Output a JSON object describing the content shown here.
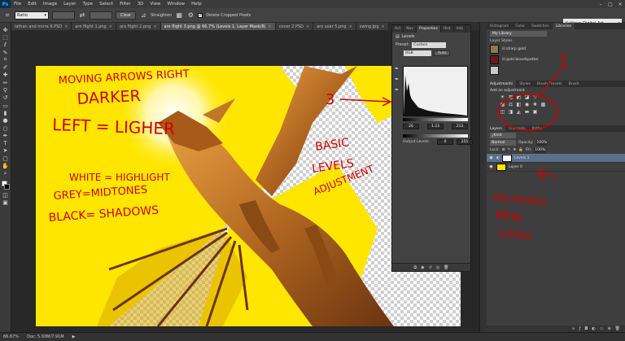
{
  "app": {
    "logo": "Ps"
  },
  "menu": [
    "File",
    "Edit",
    "Image",
    "Layer",
    "Type",
    "Select",
    "Filter",
    "3D",
    "View",
    "Window",
    "Help"
  ],
  "window_controls": [
    "–",
    "□",
    "✕"
  ],
  "options_bar": {
    "ratio_label": "Ratio",
    "clear_label": "Clear",
    "straighten_label": "Straighten",
    "delete_cropped_label": "Delete Cropped Pixels",
    "workspace_label": "Kathryn Digital Art"
  },
  "tabs": [
    {
      "label": "lathan and mirra 6.PSD",
      "active": false
    },
    {
      "label": "aro flight 1.png",
      "active": false
    },
    {
      "label": "aro flight 2.png",
      "active": false
    },
    {
      "label": "aro flight 3.png @ 66.7% (Levels 1, Layer Mask/8)",
      "active": true
    },
    {
      "label": "cover 2.PSD",
      "active": false
    },
    {
      "label": "aro soar 5.png",
      "active": false
    },
    {
      "label": "swing.jpg",
      "active": false
    }
  ],
  "properties": {
    "tabs": [
      "Act",
      "Nav",
      "Properties",
      "Hist",
      "Info"
    ],
    "title": "Levels",
    "preset_label": "Preset:",
    "preset_value": "Custom",
    "channel": "RGB",
    "auto_label": "Auto",
    "input_black": "26",
    "input_mid": "1.23",
    "input_white": "213",
    "output_label": "Output Levels:",
    "output_black": "0",
    "output_white": "255"
  },
  "right_panel": {
    "lib_tabs": [
      "Histogram",
      "Color",
      "Swatches",
      "Libraries"
    ],
    "library_select": "My Library",
    "layer_styles_label": "Layer Styles",
    "library_items": [
      {
        "label": "lil sharp gold",
        "color": "#8a7a55"
      },
      {
        "label": "lil gold bloodspatter",
        "color": "#6a1a1a"
      },
      {
        "label": "",
        "color": "#c8c8c8"
      }
    ],
    "adj_tabs": [
      "Adjustments",
      "Styles",
      "Brush Presets",
      "Brush"
    ],
    "adj_title": "Add an adjustment",
    "layers_tabs": [
      "Layers",
      "Channels",
      "Paths"
    ],
    "kind_label": "Kind",
    "blend_mode": "Normal",
    "opacity_label": "Opacity:",
    "opacity_value": "100%",
    "lock_label": "Lock:",
    "fill_label": "Fill:",
    "fill_value": "100%",
    "layers": [
      {
        "name": "Levels 1",
        "selected": true,
        "thumb": "white"
      },
      {
        "name": "Layer 0",
        "selected": false,
        "thumb": "yellow"
      }
    ]
  },
  "status": {
    "zoom": "66.67%",
    "doc": "Doc: 5.93M/7.91M"
  },
  "annotations": {
    "line1": "MOVING ARROWS RIGHT",
    "line2": "DARKER",
    "line3": "LEFT = LIGHER",
    "line4": "WHITE = HIGHLIGHT",
    "line5": "GREY=MIDTONES",
    "line6": "BLACK= SHADOWS",
    "basic1": "BASIC",
    "basic2": "LEVELS",
    "basic3": "ADJUSTMENT",
    "num3": "3",
    "num1": "1",
    "adj1": "ADJ MAKES",
    "adj2": "NEW",
    "adj3": "LAYER",
    "color": "#d00000"
  }
}
